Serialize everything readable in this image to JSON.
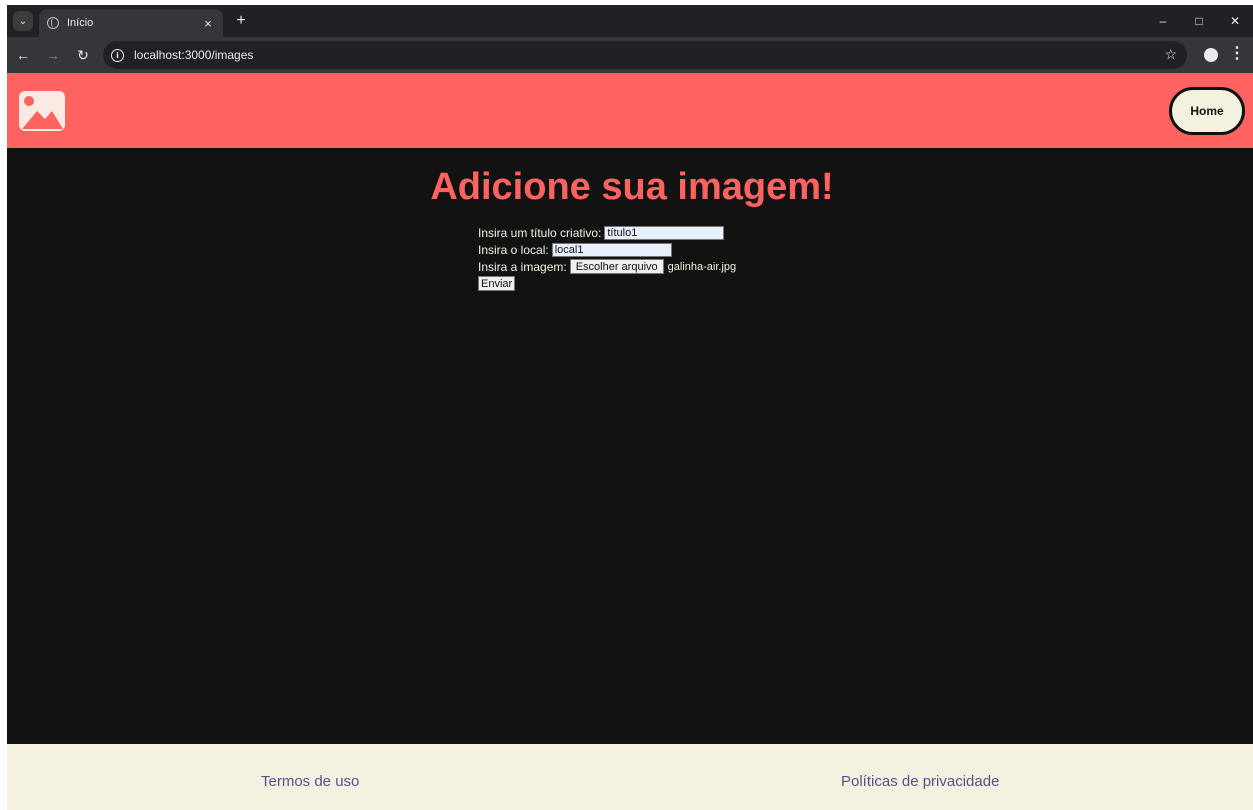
{
  "browser": {
    "tab_title": "Início",
    "tab_close": "×",
    "new_tab": "+",
    "url": "localhost:3000/images",
    "controls": {
      "minimize": "–",
      "maximize": "□",
      "close": "✕"
    },
    "icons": [
      "chevron-down-icon",
      "globe-icon",
      "back-icon",
      "forward-icon",
      "reload-icon",
      "info-icon",
      "star-icon",
      "profile-icon",
      "kebab-menu-icon"
    ]
  },
  "header": {
    "home_label": "Home",
    "accent_color": "#ff6361",
    "logo_icon": "image-icon"
  },
  "main": {
    "title": "Adicione sua imagem!",
    "form": {
      "title_label": "Insira um título criativo:",
      "title_value": "título1",
      "local_label": "Insira o local:",
      "local_value": "local1",
      "image_label": "Insira a imagem:",
      "file_button": "Escolher arquivo",
      "file_name": "galinha-air.jpg",
      "submit_label": "Enviar"
    }
  },
  "footer": {
    "terms": "Termos de uso",
    "privacy": "Políticas de privacidade"
  },
  "colors": {
    "background": "#121212",
    "footer": "#f5f1e1",
    "link": "#58508d"
  }
}
